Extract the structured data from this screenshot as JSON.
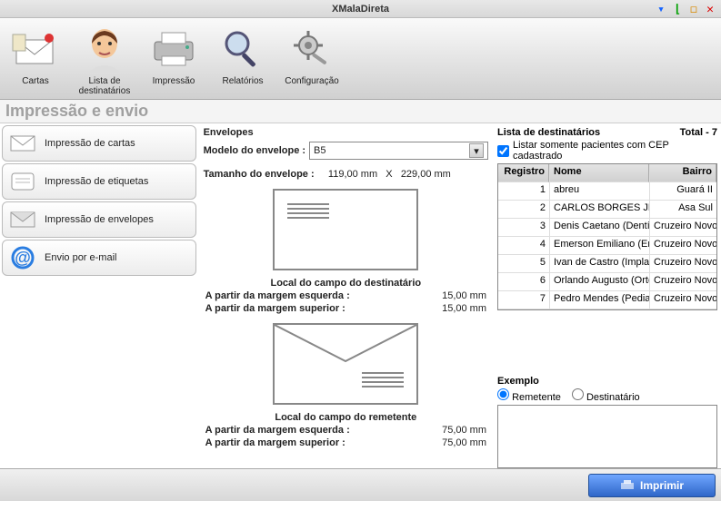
{
  "window": {
    "title": "XMalaDireta"
  },
  "toolbar": [
    {
      "label": "Cartas",
      "icon": "letter-icon"
    },
    {
      "label": "Lista de destinatários",
      "icon": "face-icon"
    },
    {
      "label": "Impressão",
      "icon": "printer-icon"
    },
    {
      "label": "Relatórios",
      "icon": "magnifier-icon"
    },
    {
      "label": "Configuração",
      "icon": "gear-icon"
    }
  ],
  "page_header": "Impressão e envio",
  "tabs": [
    {
      "label": "Impressão de cartas",
      "icon": "letter-small-icon"
    },
    {
      "label": "Impressão de etiquetas",
      "icon": "label-icon"
    },
    {
      "label": "Impressão de envelopes",
      "icon": "envelope-small-icon"
    },
    {
      "label": "Envio por e-mail",
      "icon": "at-icon"
    }
  ],
  "envelopes": {
    "title": "Envelopes",
    "model_label": "Modelo do envelope :",
    "model_value": "B5",
    "size_label": "Tamanho do envelope :",
    "size_w": "119,00 mm",
    "size_sep": "X",
    "size_h": "229,00 mm",
    "dest_title": "Local do campo do destinatário",
    "left_margin_label": "A partir da margem esquerda :",
    "top_margin_label": "A partir da margem superior :",
    "dest_left": "15,00 mm",
    "dest_top": "15,00 mm",
    "send_title": "Local do campo do remetente",
    "send_left": "75,00 mm",
    "send_top": "75,00 mm"
  },
  "recipients": {
    "title": "Lista de destinatários",
    "total_label": "Total - 7",
    "filter_label": "Listar somente pacientes com CEP cadastrado",
    "columns": {
      "reg": "Registro",
      "nome": "Nome",
      "bairro": "Bairro"
    },
    "rows": [
      {
        "reg": "1",
        "nome": "abreu",
        "bairro": "Guará II"
      },
      {
        "reg": "2",
        "nome": "CARLOS BORGES JR.",
        "bairro": "Asa Sul"
      },
      {
        "reg": "3",
        "nome": "Denis Caetano (Dentístic",
        "bairro": "Cruzeiro Novo"
      },
      {
        "reg": "4",
        "nome": "Emerson Emiliano (Endoc",
        "bairro": "Cruzeiro Novo"
      },
      {
        "reg": "5",
        "nome": "Ivan de Castro (Implantoc",
        "bairro": "Cruzeiro Novo"
      },
      {
        "reg": "6",
        "nome": "Orlando Augusto (Ortodo",
        "bairro": "Cruzeiro Novo"
      },
      {
        "reg": "7",
        "nome": "Pedro Mendes (Pediatria",
        "bairro": "Cruzeiro Novo"
      }
    ]
  },
  "example": {
    "title": "Exemplo",
    "opt_remetente": "Remetente",
    "opt_destinatario": "Destinatário"
  },
  "print_button": "Imprimir"
}
